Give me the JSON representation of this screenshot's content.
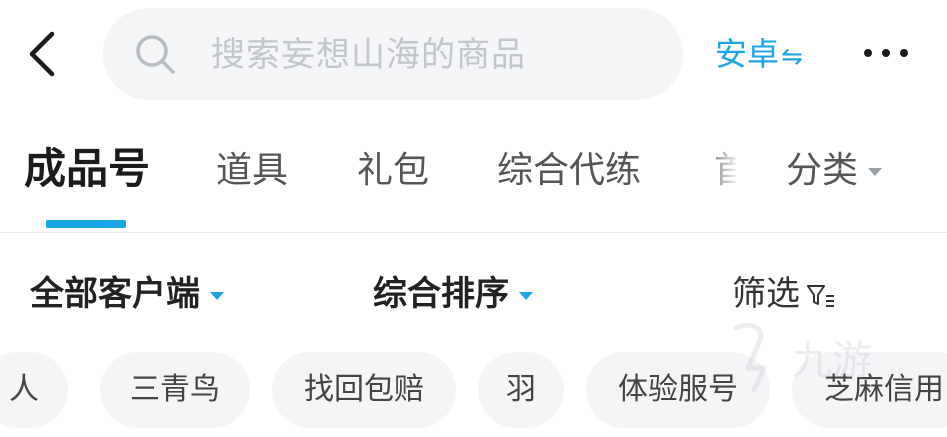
{
  "header": {
    "search_placeholder": "搜索妄想山海的商品",
    "platform_label": "安卓",
    "platform_switch_glyph": "⇋"
  },
  "tabs": [
    {
      "label": "成品号",
      "active": true
    },
    {
      "label": "道具"
    },
    {
      "label": "礼包"
    },
    {
      "label": "综合代练"
    },
    {
      "label": "首"
    }
  ],
  "category_label": "分类",
  "filters": {
    "client_label": "全部客户端",
    "sort_label": "综合排序",
    "screen_label": "筛选"
  },
  "chips": [
    "人",
    "三青鸟",
    "找回包赔",
    "羽",
    "体验服号",
    "芝麻信用"
  ],
  "watermark_text": "九游",
  "colors": {
    "accent": "#19a5e6",
    "chip_bg": "#f4f5f7",
    "search_bg": "#f4f5f7"
  }
}
